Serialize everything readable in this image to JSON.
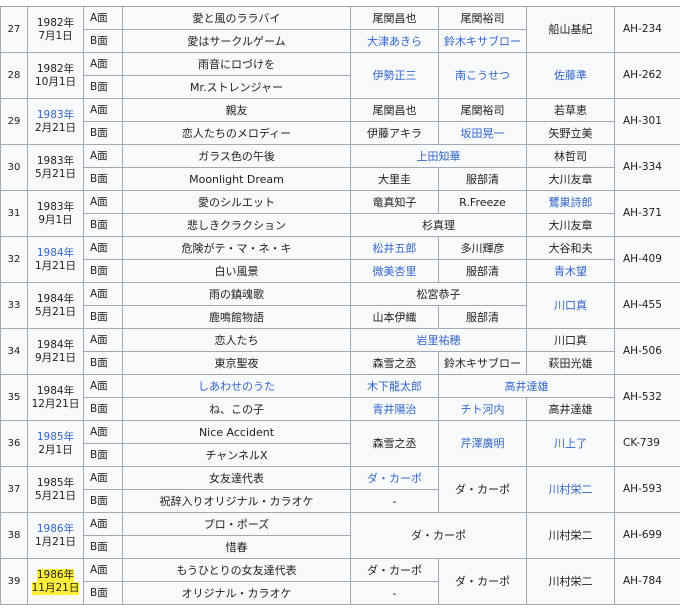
{
  "singles": [
    {
      "no": "27",
      "year": "1982年",
      "day": "7月1日",
      "year_link": false,
      "day_link": false,
      "catalog": "AH-234",
      "a_title": "愛と風のララバイ",
      "b_title": "愛はサークルゲーム",
      "a_lyrics": "尾関昌也",
      "a_music": "尾関裕司",
      "b_lyrics": "大津あきら",
      "b_music": "鈴木キサブロー",
      "arranger": "船山基紀"
    },
    {
      "no": "28",
      "year": "1982年",
      "day": "10月1日",
      "catalog": "AH-262",
      "a_title": "雨音にロづけを",
      "b_title": "Mr.ストレンジャー",
      "lyrics": "伊勢正三",
      "music": "南こうせつ",
      "arranger": "佐藤準"
    },
    {
      "no": "29",
      "year": "1983年",
      "day": "2月21日",
      "catalog": "AH-301",
      "a_title": "親友",
      "b_title": "恋人たちのメロディー",
      "a_lyrics": "尾関昌也",
      "a_music": "尾関裕司",
      "a_arranger": "若草恵",
      "b_lyrics": "伊藤アキラ",
      "b_music": "坂田晃一",
      "b_arranger": "矢野立美"
    },
    {
      "no": "30",
      "year": "1983年",
      "day": "5月21日",
      "catalog": "AH-334",
      "a_title": "ガラス色の午後",
      "b_title": "Moonlight Dream",
      "a_writer": "上田知華",
      "a_arranger": "林哲司",
      "b_lyrics": "大里圭",
      "b_music": "服部清",
      "b_arranger": "大川友章"
    },
    {
      "no": "31",
      "year": "1983年",
      "day": "9月1日",
      "catalog": "AH-371",
      "a_title": "愛のシルエット",
      "b_title": "悲しきクラクション",
      "a_lyrics": "竜真知子",
      "a_music": "R.Freeze",
      "a_arranger": "鷺巣詩郎",
      "b_writer": "杉真理",
      "b_arranger": "大川友章"
    },
    {
      "no": "32",
      "year": "1984年",
      "day": "1月21日",
      "catalog": "AH-409",
      "a_title": "危険がテ・マ・ネ・キ",
      "b_title": "白い風景",
      "a_lyrics": "松井五郎",
      "a_music": "多川輝彦",
      "a_arranger": "大谷和夫",
      "b_lyrics": "微美杏里",
      "b_music": "服部清",
      "b_arranger": "青木望"
    },
    {
      "no": "33",
      "year": "1984年",
      "day": "5月21日",
      "catalog": "AH-455",
      "a_title": "雨の鎮魂歌",
      "b_title": "鹿鳴館物語",
      "a_writer": "松宮恭子",
      "b_lyrics": "山本伊織",
      "b_music": "服部清",
      "arranger": "川口真"
    },
    {
      "no": "34",
      "year": "1984年",
      "day": "9月21日",
      "catalog": "AH-506",
      "a_title": "恋人たち",
      "b_title": "東京聖夜",
      "a_writer": "岩里祐穂",
      "a_arranger": "川口真",
      "b_lyrics": "森雪之丞",
      "b_music": "鈴木キサブロー",
      "b_arranger": "萩田光雄"
    },
    {
      "no": "35",
      "year": "1984年",
      "day": "12月21日",
      "catalog": "AH-532",
      "a_title": "しあわせのうた",
      "b_title": "ね、この子",
      "a_lyrics": "木下龍太郎",
      "a_music_arranger": "高井達雄",
      "b_lyrics": "青井陽治",
      "b_music": "チト河内",
      "b_arranger": "高井達雄"
    },
    {
      "no": "36",
      "year": "1985年",
      "day": "2月1日",
      "catalog": "CK-739",
      "a_title": "Nice Accident",
      "b_title": "チャンネルX",
      "lyrics": "森雪之丞",
      "music": "芹澤廣明",
      "arranger": "川上了"
    },
    {
      "no": "37",
      "year": "1985年",
      "day": "5月21日",
      "catalog": "AH-593",
      "a_title": "女友達代表",
      "b_title": "祝辞入りオリジナル・カラオケ",
      "a_lyrics": "ダ・カーポ",
      "b_lyrics": "-",
      "music": "ダ・カーポ",
      "arranger": "川村栄二"
    },
    {
      "no": "38",
      "year": "1986年",
      "day": "1月21日",
      "catalog": "AH-699",
      "a_title": "プロ・ポーズ",
      "b_title": "惜春",
      "writer": "ダ・カーポ",
      "arranger": "川村栄二"
    },
    {
      "no": "39",
      "year": "1986年",
      "day": "11月21日",
      "catalog": "AH-784",
      "a_title": "もうひとりの女友達代表",
      "b_title": "オリジナル・カラオケ",
      "a_lyrics": "ダ・カーポ",
      "b_lyrics": "-",
      "music": "ダ・カーポ",
      "arranger": "川村栄二"
    }
  ],
  "side_a": "A面",
  "side_b": "B面"
}
